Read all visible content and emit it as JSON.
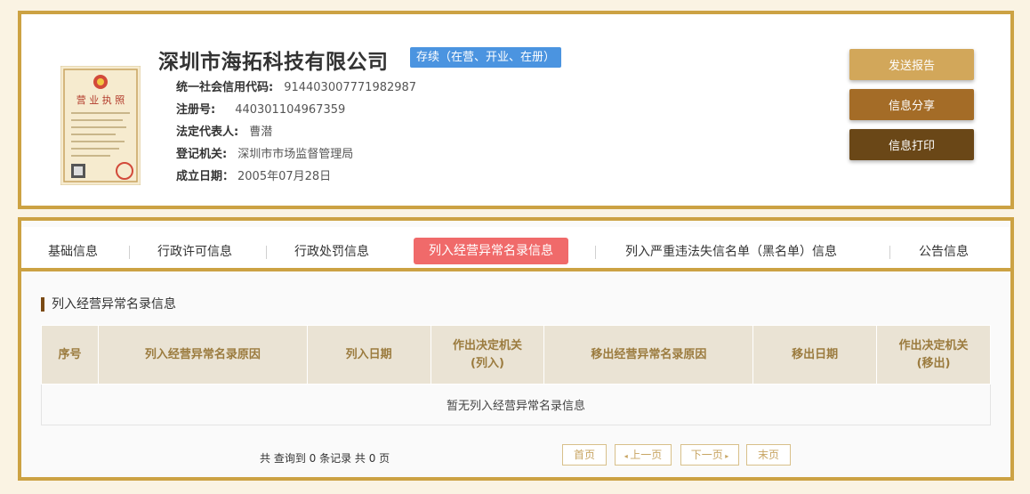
{
  "company": {
    "name": "深圳市海拓科技有限公司",
    "status": "存续（在营、开业、在册）",
    "fields": [
      {
        "label": "统一社会信用代码:",
        "value": "914403007771982987"
      },
      {
        "label": "注册号:",
        "value": "440301104967359"
      },
      {
        "label": "法定代表人:",
        "value": "曹潜"
      },
      {
        "label": "登记机关:",
        "value": "深圳市市场监督管理局"
      },
      {
        "label": "成立日期：",
        "value": "2005年07月28日"
      }
    ],
    "license_title": "营业执照"
  },
  "actions": {
    "send": "发送报告",
    "share": "信息分享",
    "print": "信息打印"
  },
  "colors": {
    "border": "#cca243",
    "active_tab": "#f06a6a",
    "badge": "#4b94e0"
  },
  "tabs": [
    {
      "label": "基础信息",
      "active": false
    },
    {
      "label": "行政许可信息",
      "active": false
    },
    {
      "label": "行政处罚信息",
      "active": false
    },
    {
      "label": "列入经营异常名录信息",
      "active": true
    },
    {
      "label": "列入严重违法失信名单（黑名单）信息",
      "active": false
    },
    {
      "label": "公告信息",
      "active": false
    }
  ],
  "section": {
    "title": "列入经营异常名录信息",
    "columns": [
      "序号",
      "列入经营异常名录原因",
      "列入日期",
      "作出决定机关\n(列入)",
      "移出经营异常名录原因",
      "移出日期",
      "作出决定机关\n(移出)"
    ],
    "empty_text": "暂无列入经营异常名录信息"
  },
  "pager": {
    "summary": "共 查询到 0 条记录 共 0 页",
    "first": "首页",
    "prev": "上一页",
    "next": "下一页",
    "last": "末页"
  }
}
